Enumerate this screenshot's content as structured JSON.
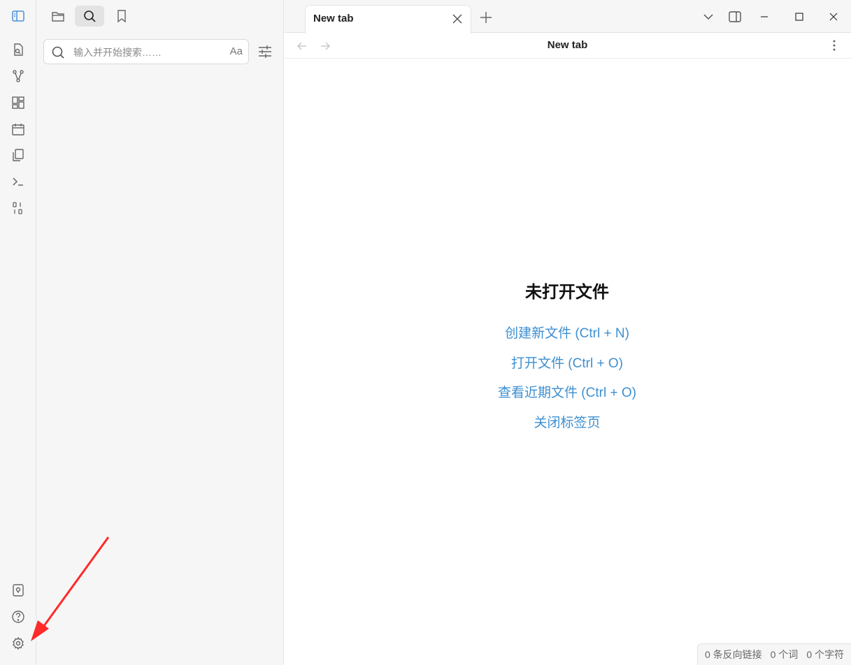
{
  "ribbon": {
    "top_icons": [
      "sidebar-toggle-icon",
      "open-quick-switcher-icon",
      "graph-view-icon",
      "canvas-icon",
      "daily-note-icon",
      "templates-icon",
      "command-palette-icon",
      "binary-icon"
    ],
    "bottom_icons": [
      "vault-icon",
      "help-icon",
      "settings-icon"
    ]
  },
  "sidebar": {
    "tabs": [
      "files-icon",
      "search-icon",
      "bookmark-icon"
    ],
    "active_tab": "search",
    "search": {
      "placeholder": "输入并开始搜索……",
      "value": "",
      "case_label": "Aa"
    }
  },
  "tab": {
    "title": "New tab"
  },
  "view": {
    "title": "New tab"
  },
  "empty_state": {
    "title": "未打开文件",
    "links": [
      "创建新文件 (Ctrl + N)",
      "打开文件 (Ctrl + O)",
      "查看近期文件 (Ctrl + O)",
      "关闭标签页"
    ]
  },
  "status": {
    "backlinks": "0 条反向链接",
    "words": "0 个词",
    "chars": "0 个字符"
  },
  "colors": {
    "accent": "#3d8fd1",
    "background": "#f6f6f6",
    "annotation": "#ff2a2a"
  }
}
